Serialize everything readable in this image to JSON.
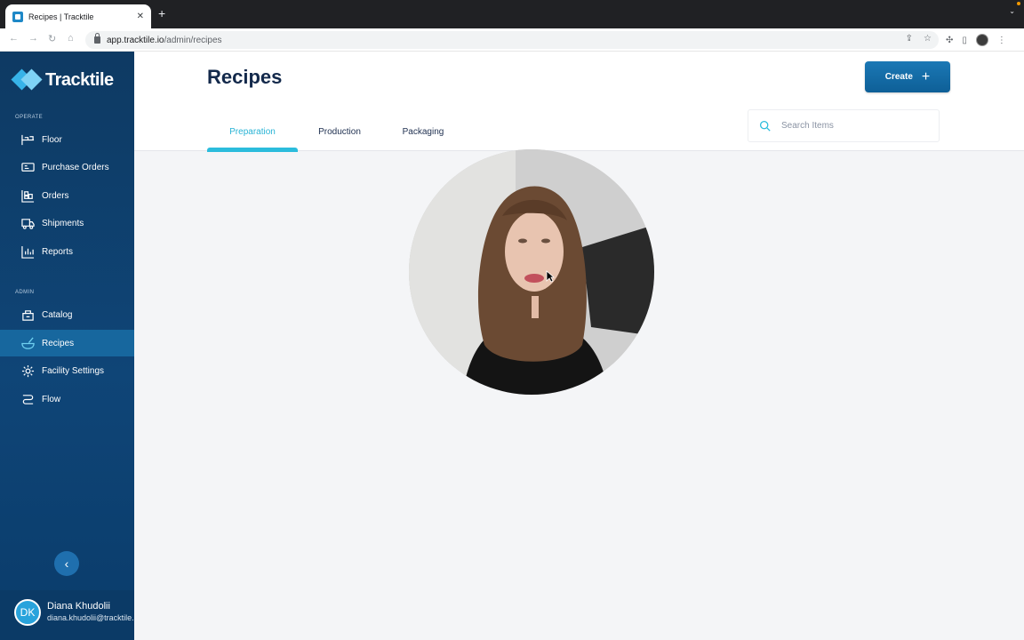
{
  "browser": {
    "tab_title": "Recipes | Tracktile",
    "url_host": "app.tracktile.io",
    "url_path": "/admin/recipes"
  },
  "sidebar": {
    "logo_text": "Tracktile",
    "sections": [
      {
        "label": "OPERATE",
        "items": [
          {
            "label": "Floor",
            "icon": "floor-icon"
          },
          {
            "label": "Purchase Orders",
            "icon": "purchase-orders-icon"
          },
          {
            "label": "Orders",
            "icon": "orders-icon"
          },
          {
            "label": "Shipments",
            "icon": "truck-icon"
          },
          {
            "label": "Reports",
            "icon": "bar-chart-icon"
          }
        ]
      },
      {
        "label": "ADMIN",
        "items": [
          {
            "label": "Catalog",
            "icon": "catalog-icon"
          },
          {
            "label": "Recipes",
            "icon": "mortar-pestle-icon",
            "active": true
          },
          {
            "label": "Facility Settings",
            "icon": "gear-icon"
          },
          {
            "label": "Flow",
            "icon": "flow-icon"
          }
        ]
      }
    ],
    "user": {
      "initials": "DK",
      "name": "Diana Khudolii",
      "email": "diana.khudolii@tracktile.io"
    }
  },
  "main": {
    "title": "Recipes",
    "create_label": "Create",
    "tabs": [
      {
        "label": "Preparation",
        "active": true
      },
      {
        "label": "Production"
      },
      {
        "label": "Packaging"
      }
    ],
    "search_placeholder": "Search Items"
  },
  "colors": {
    "sidebar_bg": "#0f4577",
    "active_item": "#17679e",
    "accent": "#2bbcdc",
    "title": "#13294b"
  }
}
